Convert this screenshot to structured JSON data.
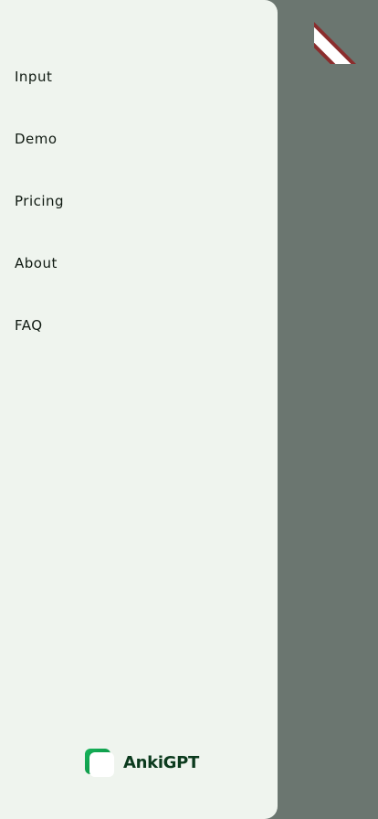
{
  "menu": {
    "items": [
      {
        "label": "Input"
      },
      {
        "label": "Demo"
      },
      {
        "label": "Pricing"
      },
      {
        "label": "About"
      },
      {
        "label": "FAQ"
      }
    ]
  },
  "brand": {
    "name": "AnkiGPT",
    "logo_icon": "ankigpt-logo-icon"
  },
  "colors": {
    "drawer_background": "#eff4ee",
    "backdrop": "#6b7670",
    "brand_green": "#0b3a1d",
    "logo_green": "#16b35a",
    "ribbon_red": "#8b2d2d"
  }
}
